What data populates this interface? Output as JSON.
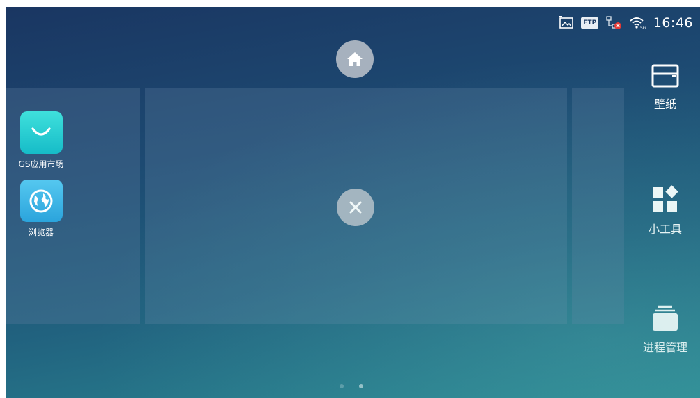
{
  "status_bar": {
    "icons": [
      "gallery-icon",
      "ftp-icon",
      "network-disconnected-icon",
      "wifi-5g-icon"
    ],
    "ftp_label": "FTP",
    "time": "16:46"
  },
  "controls": {
    "home_icon": "home-icon",
    "close_icon": "close-icon"
  },
  "apps": [
    {
      "label": "GS应用市场",
      "icon": "shopping-bag-icon"
    },
    {
      "label": "浏览器",
      "icon": "globe-icon"
    }
  ],
  "tools": [
    {
      "label": "壁纸",
      "icon": "wallpaper-icon"
    },
    {
      "label": "小工具",
      "icon": "widgets-icon"
    },
    {
      "label": "进程管理",
      "icon": "task-manager-icon"
    }
  ],
  "pagination": {
    "count": 2,
    "active": 1
  },
  "colors": {
    "accent": "#21c9d2",
    "background": "#1d4a72"
  }
}
